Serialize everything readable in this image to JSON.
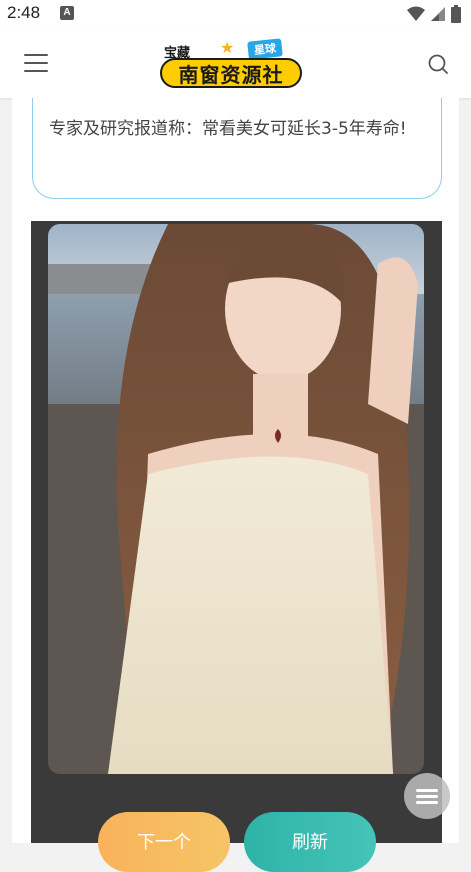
{
  "status_bar": {
    "time": "2:48",
    "notification_icon": "A",
    "icons": [
      "wifi-icon",
      "signal-icon",
      "battery-icon"
    ]
  },
  "header": {
    "logo": {
      "top_text": "宝藏",
      "tag_text": "星球",
      "main_text": "南窗资源社"
    },
    "menu_icon": "hamburger-menu-icon",
    "search_icon": "search-icon"
  },
  "quote": {
    "text": "专家及研究报道称：常看美女可延长3-5年寿命!"
  },
  "image": {
    "description_icon": "photo"
  },
  "buttons": {
    "next_label": "下一个",
    "refresh_label": "刷新"
  },
  "colors": {
    "bubble_border": "#8ccfee",
    "next_button": "#f9b35a",
    "refresh_button": "#2eb3a9",
    "frame_bg": "#3a3a3a"
  }
}
